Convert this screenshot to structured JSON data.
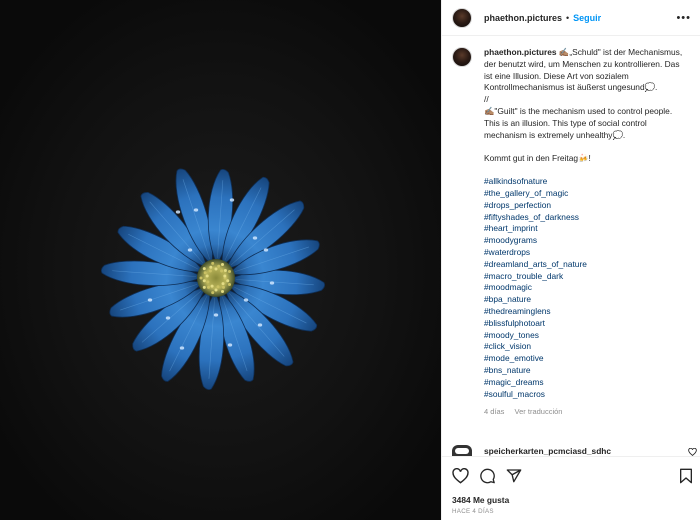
{
  "post": {
    "author": "phaethon.pictures",
    "separator": "•",
    "follow_label": "Seguir",
    "more_label": "•••"
  },
  "caption": {
    "username": "phaethon.pictures",
    "text_de": " ✍🏽„Schuld\" ist der Mechanismus, der benutzt wird, um Menschen zu kontrollieren. Das ist eine Illusion. Diese Art von sozialem Kontrollmechanismus ist äußerst ungesund💭.",
    "separator": "//",
    "text_en": "✍🏽\"Guilt\" is the mechanism used to control people. This is an illusion. This type of social control mechanism is extremely unhealthy💭.",
    "closing": "Kommt gut in den Freitag🍻!",
    "hashtags": [
      "#allkindsofnature",
      "#the_gallery_of_magic",
      "#drops_perfection",
      "#fiftyshades_of_darkness",
      "#heart_imprint",
      "#moodygrams",
      "#waterdrops",
      "#dreamland_arts_of_nature",
      "#macro_trouble_dark",
      "#moodmagic",
      "#bpa_nature",
      "#thedreaminglens",
      "#blissfulphotoart",
      "#moody_tones",
      "#click_vision",
      "#mode_emotive",
      "#bns_nature",
      "#magic_dreams",
      "#soulful_macros"
    ],
    "time": "4 días",
    "translate_label": "Ver traducción"
  },
  "comment": {
    "username": "speicherkarten_pcmciasd_sdhc"
  },
  "footer": {
    "likes": "3484 Me gusta",
    "date": "HACE 4 DÍAS"
  },
  "icons": [
    "heart-icon",
    "comment-icon",
    "share-icon",
    "bookmark-icon"
  ],
  "colors": {
    "accent": "#0095f6",
    "hashtag": "#00376b",
    "muted": "#8e8e8e",
    "flower": "#2e6fb8"
  }
}
